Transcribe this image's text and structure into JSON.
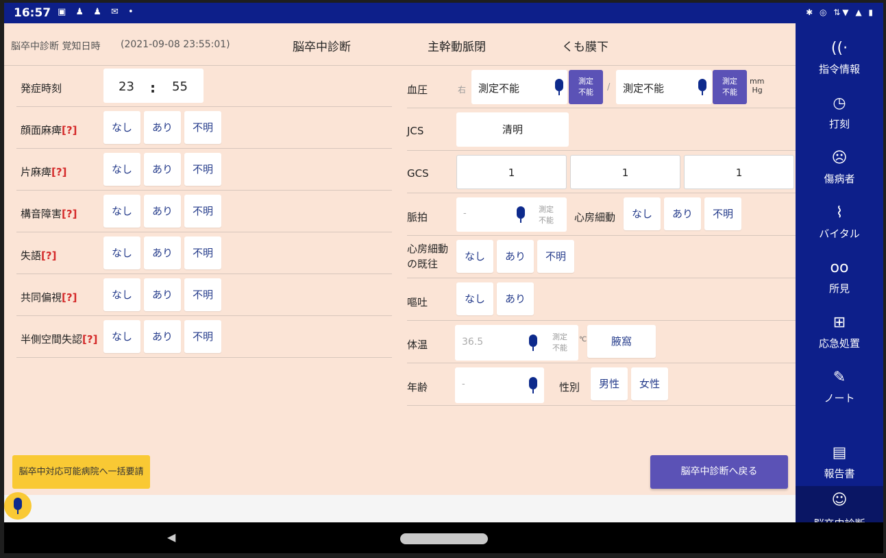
{
  "status": {
    "time": "16:57",
    "left_icons": "▣ ♟ ♟ ✉ •",
    "right_icons": "✱ ◎ ⇅▼ ▲ ▮"
  },
  "header": {
    "subtitle": "脳卒中診断 覚知日時",
    "datetime": "(2021-09-08 23:55:01)"
  },
  "tabs": [
    "脳卒中診断",
    "主幹動脈閉",
    "くも膜下"
  ],
  "left": {
    "onset": {
      "label": "発症時刻",
      "hour": "23",
      "sep": ":",
      "minute": "55"
    },
    "rows": [
      {
        "label": "顔面麻痺",
        "help": "[?]",
        "opts": [
          "なし",
          "あり",
          "不明"
        ]
      },
      {
        "label": "片麻痺",
        "help": "[?]",
        "opts": [
          "なし",
          "あり",
          "不明"
        ]
      },
      {
        "label": "構音障害",
        "help": "[?]",
        "opts": [
          "なし",
          "あり",
          "不明"
        ]
      },
      {
        "label": "失語",
        "help": "[?]",
        "opts": [
          "なし",
          "あり",
          "不明"
        ]
      },
      {
        "label": "共同偏視",
        "help": "[?]",
        "opts": [
          "なし",
          "あり",
          "不明"
        ]
      },
      {
        "label": "半側空間失認",
        "help": "[?]",
        "opts": [
          "なし",
          "あり",
          "不明"
        ]
      }
    ]
  },
  "right": {
    "bp": {
      "label": "血圧",
      "side": "右",
      "value1": "測定不能",
      "btn1": [
        "測定",
        "不能"
      ],
      "sep": "/",
      "value2": "測定不能",
      "btn2": [
        "測定",
        "不能"
      ],
      "unit": [
        "mm",
        "Hg"
      ]
    },
    "jcs": {
      "label": "JCS",
      "value": "清明"
    },
    "gcs": {
      "label": "GCS",
      "values": [
        "1",
        "1",
        "1"
      ]
    },
    "pulse": {
      "label": "脈拍",
      "placeholder": "-",
      "unmeasurable": [
        "測定",
        "不能"
      ],
      "af_label": "心房細動",
      "opts": [
        "なし",
        "あり",
        "不明"
      ]
    },
    "af_history": {
      "label": [
        "心房細動",
        "の既往"
      ],
      "opts": [
        "なし",
        "あり",
        "不明"
      ]
    },
    "vomit": {
      "label": "嘔吐",
      "opts": [
        "なし",
        "あり"
      ]
    },
    "temp": {
      "label": "体温",
      "placeholder": "36.5",
      "unmeasurable": [
        "測定",
        "不能"
      ],
      "unit": "℃",
      "site": "腋窩"
    },
    "age": {
      "label": "年齢",
      "placeholder": "-",
      "sex_label": "性別",
      "opts": [
        "男性",
        "女性"
      ]
    }
  },
  "buttons": {
    "bulk_request": "脳卒中対応可能病院へ一括要請",
    "back": "脳卒中診断へ戻る"
  },
  "sidebar": [
    {
      "label": "指令情報",
      "icon": "broadcast-icon"
    },
    {
      "label": "打刻",
      "icon": "clock-icon"
    },
    {
      "label": "傷病者",
      "icon": "face-icon"
    },
    {
      "label": "バイタル",
      "icon": "pulse-icon"
    },
    {
      "label": "所見",
      "icon": "glasses-icon"
    },
    {
      "label": "応急処置",
      "icon": "first-aid-icon"
    },
    {
      "label": "ノート",
      "icon": "pencil-icon"
    },
    {
      "label": "報告書",
      "icon": "report-icon"
    },
    {
      "label": "脳卒中診断",
      "icon": "brain-icon"
    }
  ],
  "colors": {
    "primary": "#0d1f8a",
    "background": "#fbe4d6",
    "accent": "#5b52b6",
    "warning": "#f9c934"
  }
}
